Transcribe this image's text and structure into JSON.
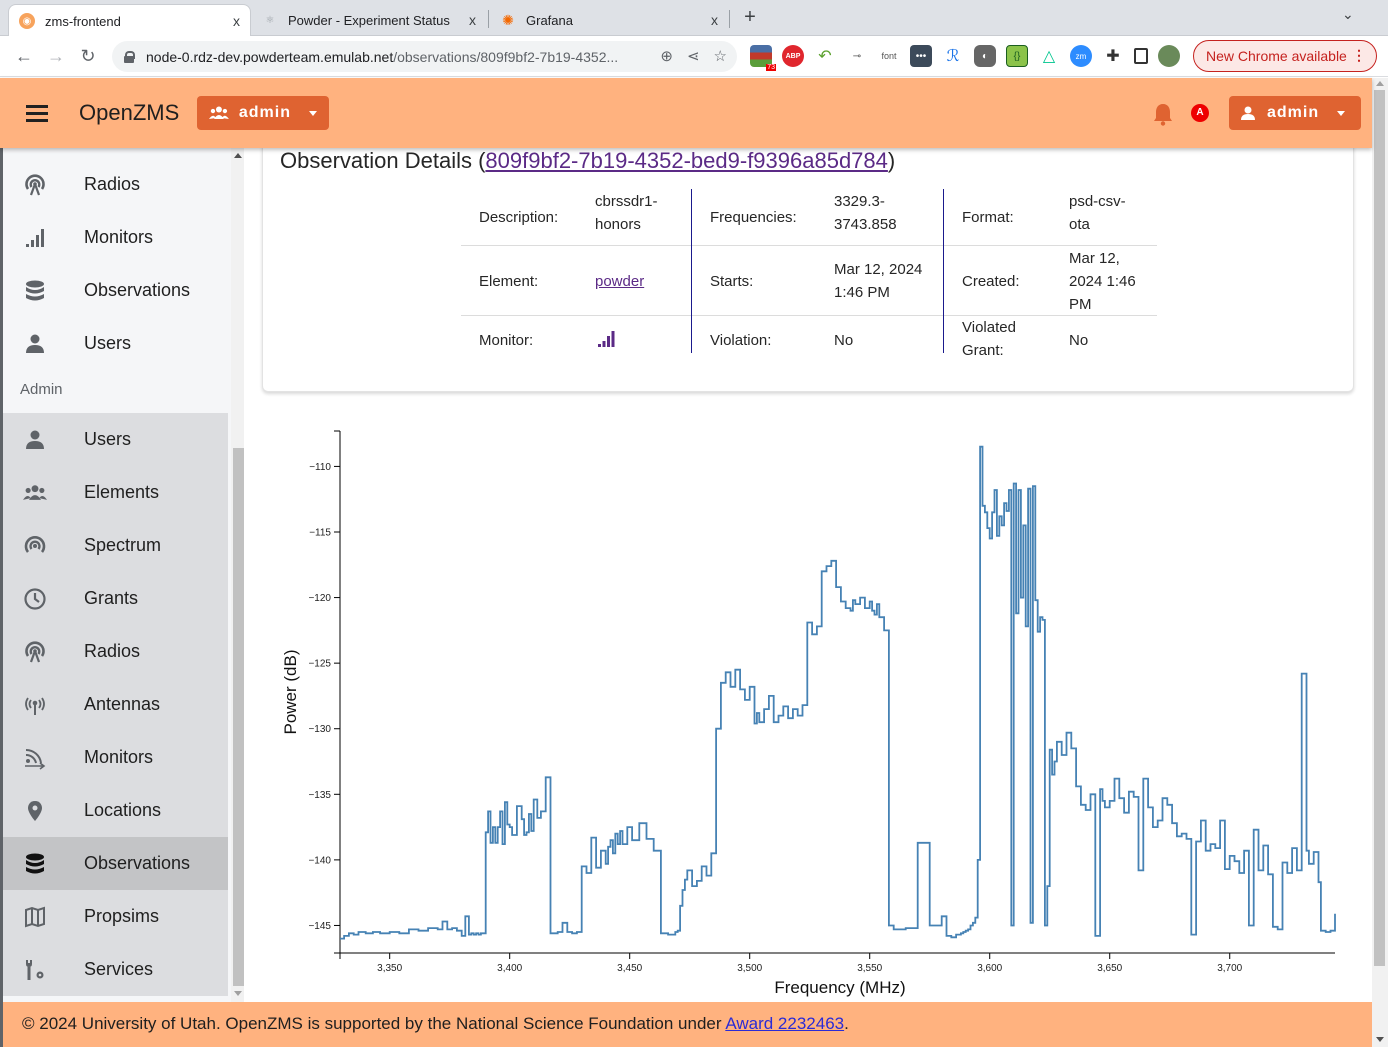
{
  "browser": {
    "tabs": [
      {
        "title": "zms-frontend",
        "active": true
      },
      {
        "title": "Powder - Experiment Status",
        "active": false
      },
      {
        "title": "Grafana",
        "active": false
      }
    ],
    "close_glyph": "x",
    "new_tab_glyph": "+",
    "url_host": "node-0.rdz-dev.powderteam.emulab.net",
    "url_path": "/observations/809f9bf2-7b19-4352...",
    "update_label": "New Chrome available",
    "extension_badge": "73",
    "extension_font_label": "font"
  },
  "header": {
    "brand": "OpenZMS",
    "role_menu_label": "admin",
    "user_menu_label": "admin",
    "notification_avatar_letter": "A"
  },
  "sidebar": {
    "items": [
      {
        "label": "Radios",
        "icon": "radio-tower-icon"
      },
      {
        "label": "Monitors",
        "icon": "signal-bars-icon"
      },
      {
        "label": "Observations",
        "icon": "database-icon"
      },
      {
        "label": "Users",
        "icon": "user-icon"
      }
    ],
    "admin_section_label": "Admin",
    "admin_items": [
      {
        "label": "Users",
        "icon": "user-icon"
      },
      {
        "label": "Elements",
        "icon": "users-group-icon"
      },
      {
        "label": "Spectrum",
        "icon": "broadcast-icon"
      },
      {
        "label": "Grants",
        "icon": "clock-icon"
      },
      {
        "label": "Radios",
        "icon": "radio-tower-icon"
      },
      {
        "label": "Antennas",
        "icon": "antenna-icon"
      },
      {
        "label": "Monitors",
        "icon": "rss-feed-icon"
      },
      {
        "label": "Locations",
        "icon": "map-pin-icon"
      },
      {
        "label": "Observations",
        "icon": "database-icon",
        "selected": true
      },
      {
        "label": "Propsims",
        "icon": "map-icon"
      },
      {
        "label": "Services",
        "icon": "wrench-gear-icon"
      }
    ]
  },
  "observation": {
    "title_prefix": "Observation Details (",
    "id": "809f9bf2-7b19-4352-bed9-f9396a85d784",
    "title_suffix": ")",
    "fields": {
      "description_label": "Description:",
      "description_value_1": "cbrssdr1-",
      "description_value_2": "honors",
      "frequencies_label": "Frequencies:",
      "frequencies_value_1": "3329.3-",
      "frequencies_value_2": "3743.858",
      "format_label": "Format:",
      "format_value_1": "psd-csv-",
      "format_value_2": "ota",
      "element_label": "Element:",
      "element_value": "powder",
      "starts_label": "Starts:",
      "starts_value_1": "Mar 12, 2024",
      "starts_value_2": "1:46 PM",
      "created_label": "Created:",
      "created_value_1": "Mar 12,",
      "created_value_2": "2024 1:46",
      "created_value_3": "PM",
      "monitor_label": "Monitor:",
      "monitor_icon": "signal-bars-icon",
      "violation_label": "Violation:",
      "violation_value": "No",
      "violated_grant_label_1": "Violated",
      "violated_grant_label_2": "Grant:",
      "violated_grant_value": "No"
    }
  },
  "colors": {
    "header_bg": "#ffb27f",
    "button_bg": "#df6331",
    "link": "#5b2a86",
    "series": "#4682b4"
  },
  "chart_data": {
    "type": "line",
    "step": true,
    "title": "",
    "xlabel": "Frequency (MHz)",
    "ylabel": "Power (dB)",
    "xlim": [
      3329.3,
      3743.858
    ],
    "ylim": [
      -147.1,
      -107.3
    ],
    "xticks": [
      3350,
      3400,
      3450,
      3500,
      3550,
      3600,
      3650,
      3700
    ],
    "xtick_labels": [
      "3,350",
      "3,400",
      "3,450",
      "3,500",
      "3,550",
      "3,600",
      "3,650",
      "3,700"
    ],
    "yticks": [
      -110,
      -115,
      -120,
      -125,
      -130,
      -135,
      -140,
      -145
    ],
    "ytick_labels": [
      "−110",
      "−115",
      "−120",
      "−125",
      "−130",
      "−135",
      "−140",
      "−145"
    ],
    "grid": false,
    "legend": "none",
    "series": [
      {
        "name": "Power",
        "x": [
          3329.3,
          3331,
          3333,
          3335,
          3337,
          3340,
          3343,
          3346,
          3350,
          3354,
          3358,
          3362,
          3366,
          3370,
          3372,
          3374,
          3376,
          3378,
          3380,
          3381.5,
          3383,
          3384,
          3385,
          3386,
          3387,
          3388,
          3390,
          3391,
          3392,
          3393,
          3394,
          3395,
          3396,
          3397,
          3398,
          3399,
          3400,
          3401,
          3403,
          3405,
          3406,
          3407,
          3408,
          3409,
          3410,
          3411.5,
          3413,
          3415,
          3417,
          3420,
          3422,
          3424,
          3426,
          3428,
          3430,
          3432,
          3434,
          3436,
          3438,
          3440,
          3441,
          3442,
          3443,
          3444,
          3445,
          3446,
          3447,
          3449,
          3451,
          3454,
          3457,
          3460,
          3463,
          3466,
          3469,
          3470,
          3471,
          3472,
          3473,
          3474,
          3476,
          3478,
          3480,
          3482,
          3484,
          3486,
          3488,
          3490,
          3492,
          3494,
          3496,
          3498,
          3500,
          3502,
          3503,
          3504,
          3506,
          3508,
          3510,
          3512,
          3514,
          3516,
          3518,
          3520,
          3522,
          3524,
          3526,
          3528,
          3530,
          3532,
          3534,
          3536,
          3538,
          3540,
          3542,
          3543,
          3544,
          3546,
          3548,
          3550,
          3551,
          3552,
          3553,
          3554,
          3556,
          3558,
          3560,
          3565,
          3570,
          3575,
          3580,
          3582,
          3584,
          3586,
          3588,
          3589,
          3590,
          3591,
          3592,
          3593,
          3594,
          3595,
          3596,
          3597,
          3598,
          3599,
          3600,
          3601,
          3602,
          3603,
          3604,
          3605,
          3606,
          3607,
          3608,
          3609,
          3610,
          3611,
          3612,
          3613,
          3614,
          3615,
          3616,
          3617,
          3618,
          3619,
          3620,
          3621,
          3622,
          3623,
          3624,
          3625,
          3626,
          3627,
          3628,
          3630,
          3632,
          3634,
          3636,
          3638,
          3640,
          3642,
          3644,
          3646,
          3647,
          3648,
          3650,
          3652,
          3654,
          3656,
          3658,
          3660,
          3662,
          3664,
          3666,
          3668,
          3670,
          3672,
          3674,
          3676,
          3678,
          3680,
          3682,
          3684,
          3686,
          3688,
          3690,
          3692,
          3694,
          3696,
          3698,
          3700,
          3702,
          3704,
          3706,
          3708,
          3710,
          3712,
          3714,
          3716,
          3718,
          3720,
          3722,
          3724,
          3726,
          3728,
          3730,
          3732,
          3733,
          3735,
          3737,
          3738,
          3740,
          3742,
          3743.858
        ],
        "y": [
          -146.0,
          -145.8,
          -145.6,
          -145.7,
          -145.5,
          -145.6,
          -145.5,
          -145.6,
          -145.5,
          -145.6,
          -145.3,
          -145.4,
          -145.2,
          -145.3,
          -144.7,
          -145.3,
          -145.2,
          -145.4,
          -145.8,
          -144.3,
          -145.7,
          -145.6,
          -145.7,
          -145.6,
          -145.7,
          -145.6,
          -137.9,
          -136.3,
          -138.7,
          -137.5,
          -138.7,
          -137.5,
          -136.3,
          -138.8,
          -135.6,
          -137.3,
          -137.5,
          -138.1,
          -135.9,
          -136.9,
          -138.1,
          -137.9,
          -136.5,
          -137.8,
          -135.4,
          -136.8,
          -136.3,
          -133.7,
          -145.6,
          -145.5,
          -144.8,
          -145.5,
          -145.6,
          -145.5,
          -140.5,
          -141.0,
          -138.3,
          -140.6,
          -139.3,
          -140.3,
          -139.0,
          -138.5,
          -139.5,
          -138.0,
          -138.8,
          -137.8,
          -138.8,
          -137.5,
          -138.5,
          -137.2,
          -138.4,
          -139.3,
          -145.6,
          -145.7,
          -145.5,
          -145.4,
          -143.5,
          -142.3,
          -141.5,
          -140.8,
          -142.0,
          -141.6,
          -140.5,
          -141.2,
          -139.5,
          -130.0,
          -126.5,
          -125.7,
          -126.8,
          -125.5,
          -127.0,
          -127.8,
          -126.8,
          -129.6,
          -128.8,
          -129.5,
          -128.5,
          -127.5,
          -129.5,
          -129.0,
          -128.3,
          -129.2,
          -128.5,
          -129.0,
          -128.2,
          -121.9,
          -122.8,
          -122.2,
          -118.0,
          -117.6,
          -117.2,
          -119.2,
          -120.3,
          -120.8,
          -121.0,
          -120.2,
          -120.5,
          -120.0,
          -120.8,
          -120.3,
          -121.0,
          -121.3,
          -120.5,
          -121.5,
          -122.5,
          -145.0,
          -145.3,
          -145.2,
          -138.7,
          -145.0,
          -144.3,
          -145.8,
          -145.9,
          -145.7,
          -145.6,
          -145.5,
          -145.4,
          -145.3,
          -145.0,
          -144.8,
          -144.4,
          -140.0,
          -108.5,
          -113.0,
          -113.5,
          -114.7,
          -115.5,
          -113.5,
          -111.8,
          -115.3,
          -113.8,
          -114.5,
          -112.8,
          -113.4,
          -111.8,
          -145.0,
          -111.3,
          -121.2,
          -111.8,
          -120.0,
          -114.5,
          -122.2,
          -111.7,
          -144.8,
          -111.5,
          -120.2,
          -122.6,
          -121.5,
          -121.7,
          -145.0,
          -142.0,
          -131.6,
          -133.5,
          -132.5,
          -131.0,
          -132.0,
          -130.3,
          -131.5,
          -134.4,
          -135.8,
          -136.2,
          -135.0,
          -145.8,
          -134.6,
          -135.5,
          -136.0,
          -135.5,
          -133.8,
          -135.3,
          -136.4,
          -134.8,
          -135.2,
          -140.8,
          -133.8,
          -136.0,
          -137.5,
          -137.0,
          -135.3,
          -135.8,
          -137.2,
          -138.2,
          -138.0,
          -138.4,
          -145.7,
          -138.6,
          -137.0,
          -139.3,
          -138.8,
          -139.1,
          -137.0,
          -140.7,
          -139.7,
          -140.1,
          -141.0,
          -139.3,
          -145.0,
          -137.7,
          -140.8,
          -138.9,
          -141.1,
          -145.1,
          -145.3,
          -140.2,
          -141.0,
          -139.1,
          -140.8,
          -125.8,
          -139.3,
          -140.3,
          -139.4,
          -141.7,
          -145.4,
          -145.5,
          -145.4,
          -144.1,
          -120.9,
          -121.1,
          -121.3,
          -121.5
        ]
      }
    ]
  },
  "footer": {
    "text": "© 2024 University of Utah. OpenZMS is supported by the National Science Foundation under ",
    "link": "Award 2232463",
    "end": "."
  }
}
